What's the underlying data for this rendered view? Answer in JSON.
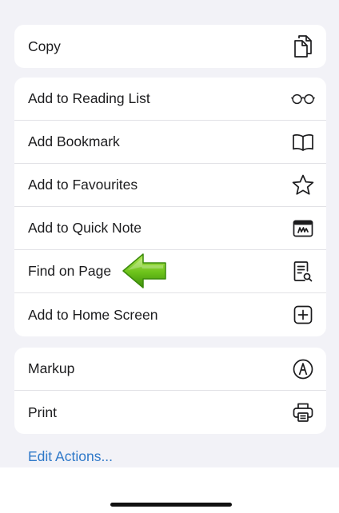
{
  "groups": [
    {
      "items": [
        {
          "label": "Copy",
          "icon": "copy-icon"
        }
      ]
    },
    {
      "items": [
        {
          "label": "Add to Reading List",
          "icon": "glasses-icon"
        },
        {
          "label": "Add Bookmark",
          "icon": "book-icon"
        },
        {
          "label": "Add to Favourites",
          "icon": "star-icon"
        },
        {
          "label": "Add to Quick Note",
          "icon": "quick-note-icon"
        },
        {
          "label": "Find on Page",
          "icon": "find-on-page-icon"
        },
        {
          "label": "Add to Home Screen",
          "icon": "plus-square-icon"
        }
      ]
    },
    {
      "items": [
        {
          "label": "Markup",
          "icon": "markup-icon"
        },
        {
          "label": "Print",
          "icon": "printer-icon"
        }
      ]
    }
  ],
  "edit_actions": "Edit Actions...",
  "colors": {
    "link": "#2f79c9",
    "arrow": "#6cc21a",
    "background": "#f2f2f7"
  }
}
